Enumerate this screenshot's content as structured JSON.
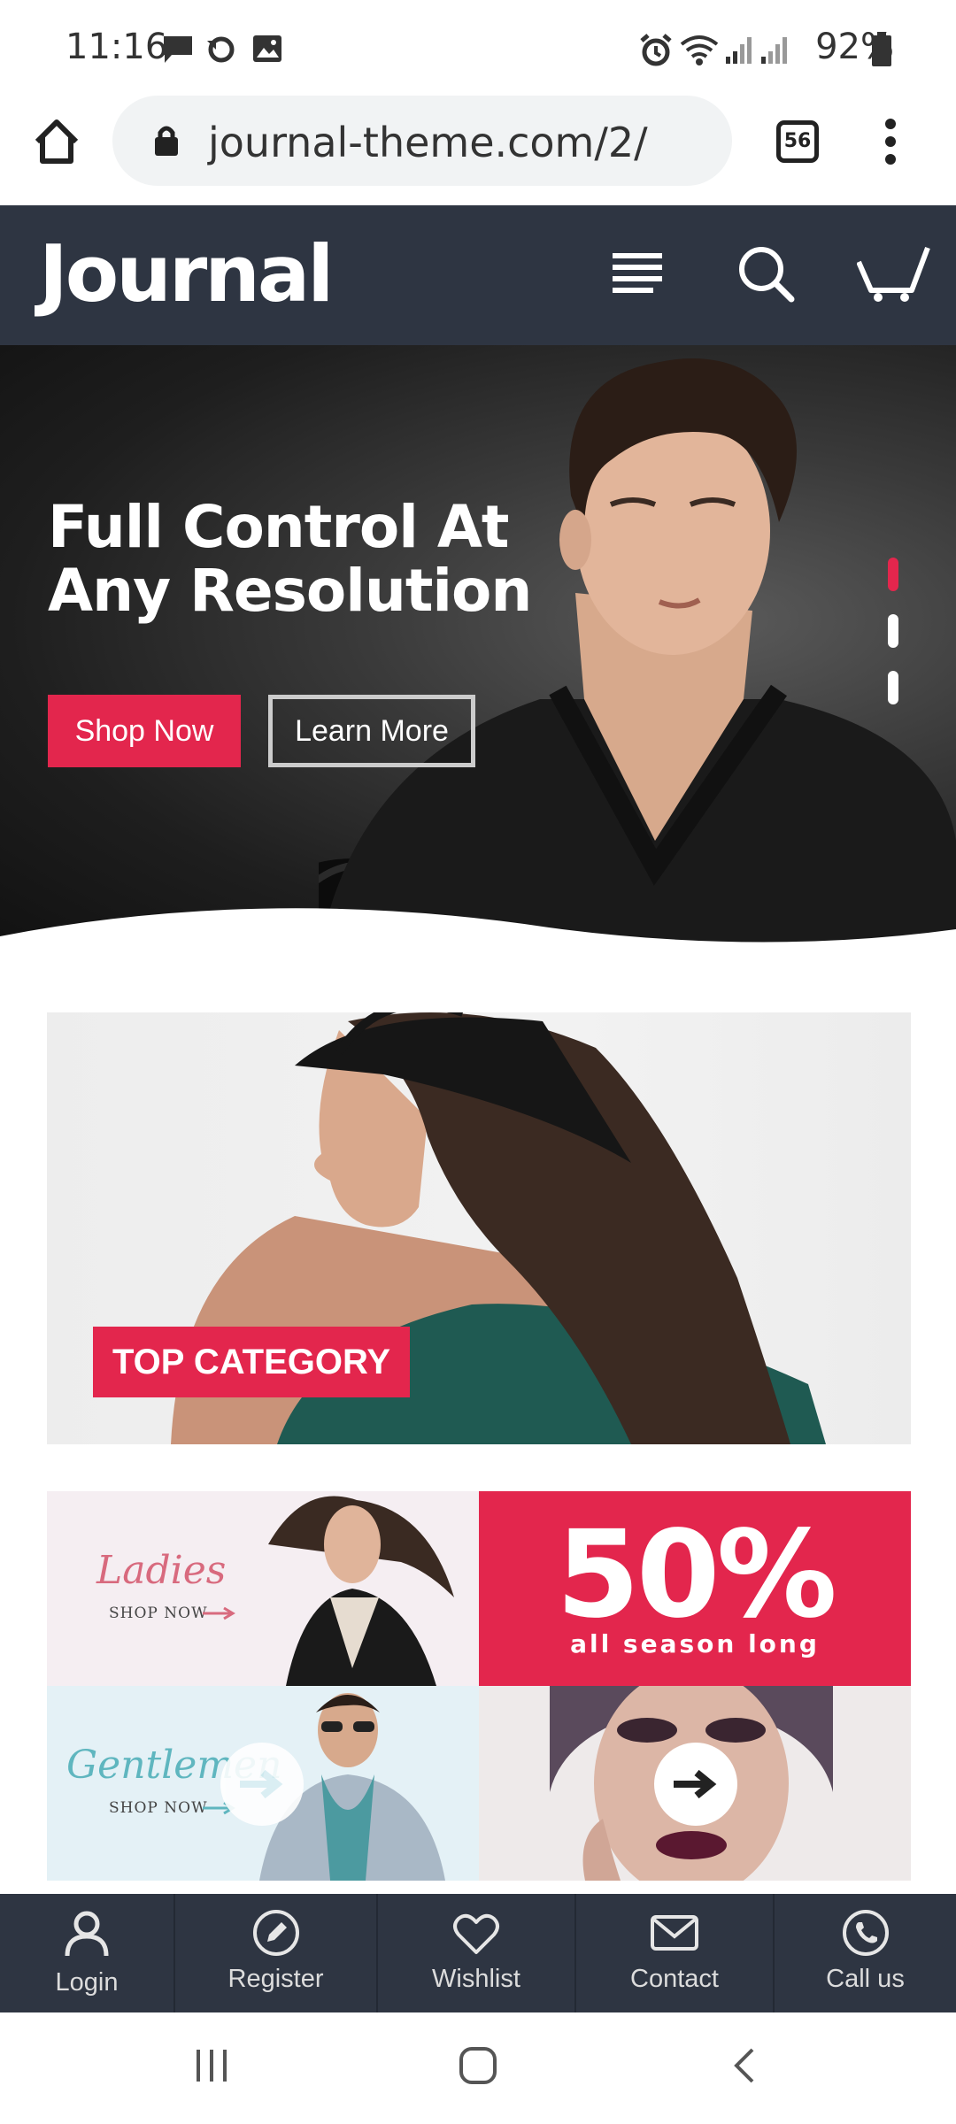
{
  "status_bar": {
    "time": "11:16",
    "battery": "92%",
    "icons": [
      "message-icon",
      "sync-icon",
      "image-icon",
      "alarm-icon",
      "wifi-icon",
      "signal-icon",
      "signal-icon",
      "battery-icon"
    ]
  },
  "browser": {
    "url": "journal-theme.com/2/",
    "tab_count": "56"
  },
  "header": {
    "logo": "Journal"
  },
  "hero": {
    "title_line1": "Full Control At",
    "title_line2": "Any Resolution",
    "primary_button": "Shop Now",
    "secondary_button": "Learn More",
    "slide_count": 3,
    "active_slide": 1
  },
  "category_banner": {
    "label": "TOP CATEGORY"
  },
  "promos": {
    "ladies": {
      "title": "Ladies",
      "cta": "SHOP NOW"
    },
    "sale": {
      "big": "50%",
      "sub": "all season long"
    },
    "gentlemen": {
      "title": "Gentlemen",
      "cta": "SHOP NOW"
    }
  },
  "bottom_nav": {
    "items": [
      {
        "label": "Login",
        "icon": "user-icon"
      },
      {
        "label": "Register",
        "icon": "pencil-icon"
      },
      {
        "label": "Wishlist",
        "icon": "heart-icon"
      },
      {
        "label": "Contact",
        "icon": "envelope-icon"
      },
      {
        "label": "Call us",
        "icon": "phone-icon"
      }
    ]
  },
  "colors": {
    "accent": "#e3264d",
    "header_bg": "#2e3542"
  }
}
